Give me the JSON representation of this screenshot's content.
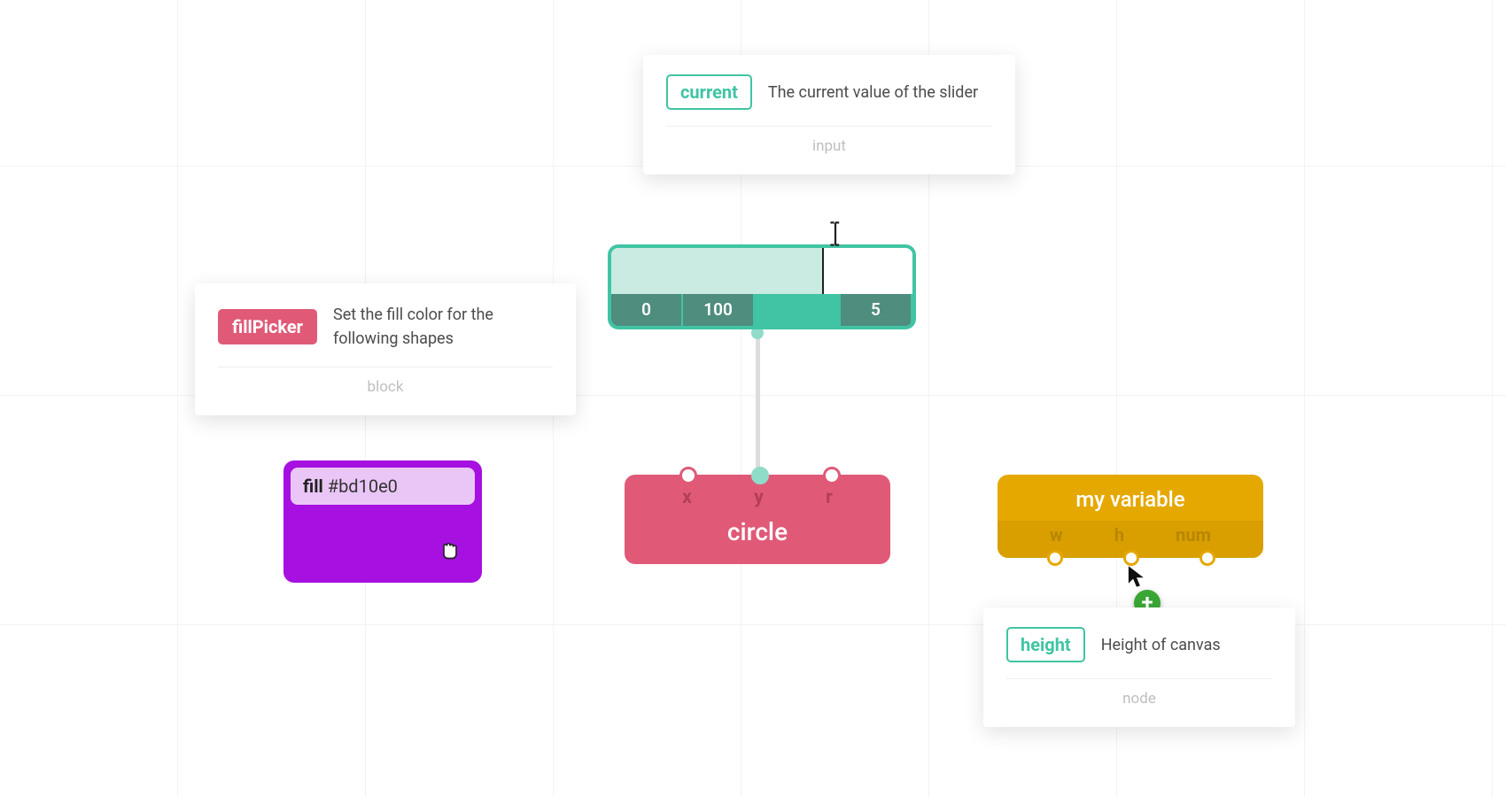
{
  "tooltips": {
    "current": {
      "tag": "current",
      "desc": "The current value of the slider",
      "foot": "input",
      "tagColor": "#40c4a4"
    },
    "fill": {
      "tag": "fillPicker",
      "desc": "Set the fill color for the following shapes",
      "foot": "block",
      "tagBg": "#e05a78",
      "tagFg": "#fff"
    },
    "height": {
      "tag": "height",
      "desc": "Height of canvas",
      "foot": "node",
      "tagColor": "#40c4a4"
    }
  },
  "fillBlock": {
    "label": "fill",
    "value": "#bd10e0"
  },
  "slider": {
    "value": "70",
    "min": "0",
    "max": "100",
    "step": "5"
  },
  "circle": {
    "title": "circle",
    "ports": [
      "x",
      "y",
      "r"
    ]
  },
  "variable": {
    "title": "my variable",
    "ports": [
      "w",
      "h",
      "num"
    ]
  }
}
